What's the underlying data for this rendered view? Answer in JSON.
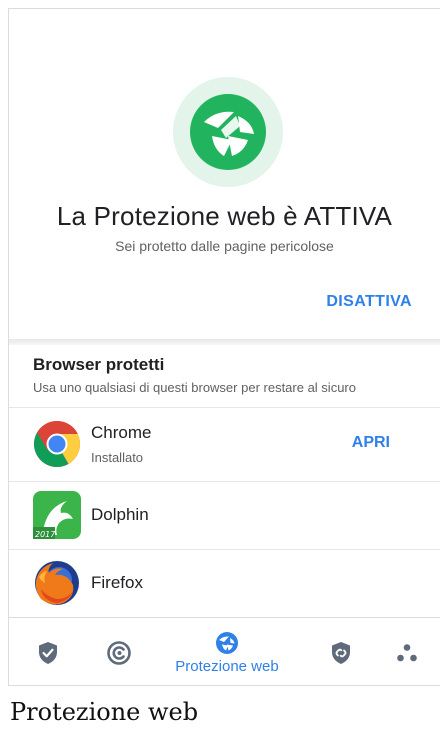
{
  "hero": {
    "title": "La Protezione web è ATTIVA",
    "subtitle": "Sei protetto dalle pagine pericolose",
    "disable_label": "DISATTIVA",
    "icon": "web-shield-icon"
  },
  "browsers": {
    "title": "Browser protetti",
    "subtitle": "Usa uno qualsiasi di questi browser per restare al sicuro",
    "items": [
      {
        "name": "Chrome",
        "status": "Installato",
        "action": "APRI",
        "icon": "chrome-icon"
      },
      {
        "name": "Dolphin",
        "icon": "dolphin-icon",
        "badge": "2017"
      },
      {
        "name": "Firefox",
        "icon": "firefox-icon"
      }
    ]
  },
  "bottom_nav": {
    "active_label": "Protezione web",
    "items": [
      "shield-icon",
      "scan-icon",
      "web-protection-icon",
      "link-shield-icon",
      "more-icon"
    ]
  },
  "caption": "Protezione web",
  "colors": {
    "accent": "#2f80e8",
    "green": "#21b35d",
    "green_light": "#e3f4ea",
    "nav_gray": "#5f6b7a"
  }
}
